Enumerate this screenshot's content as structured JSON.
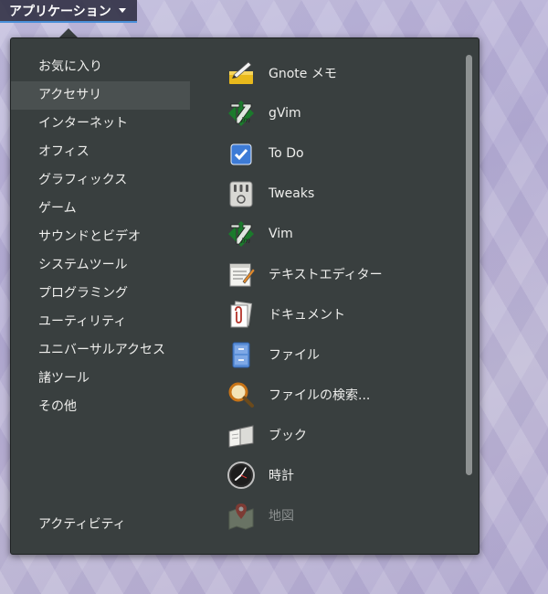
{
  "topbar": {
    "menu_label": "アプリケーション"
  },
  "categories": [
    {
      "label": "お気に入り",
      "selected": false
    },
    {
      "label": "アクセサリ",
      "selected": true
    },
    {
      "label": "インターネット",
      "selected": false
    },
    {
      "label": "オフィス",
      "selected": false
    },
    {
      "label": "グラフィックス",
      "selected": false
    },
    {
      "label": "ゲーム",
      "selected": false
    },
    {
      "label": "サウンドとビデオ",
      "selected": false
    },
    {
      "label": "システムツール",
      "selected": false
    },
    {
      "label": "プログラミング",
      "selected": false
    },
    {
      "label": "ユーティリティ",
      "selected": false
    },
    {
      "label": "ユニバーサルアクセス",
      "selected": false
    },
    {
      "label": "諸ツール",
      "selected": false
    },
    {
      "label": "その他",
      "selected": false
    }
  ],
  "activities_label": "アクティビティ",
  "apps": [
    {
      "label": "Gnote メモ",
      "icon": "gnote-icon"
    },
    {
      "label": "gVim",
      "icon": "gvim-icon"
    },
    {
      "label": "To Do",
      "icon": "todo-icon"
    },
    {
      "label": "Tweaks",
      "icon": "tweaks-icon"
    },
    {
      "label": "Vim",
      "icon": "vim-icon"
    },
    {
      "label": "テキストエディター",
      "icon": "text-editor-icon"
    },
    {
      "label": "ドキュメント",
      "icon": "document-viewer-icon"
    },
    {
      "label": "ファイル",
      "icon": "file-manager-icon"
    },
    {
      "label": "ファイルの検索...",
      "icon": "search-files-icon"
    },
    {
      "label": "ブック",
      "icon": "book-icon"
    },
    {
      "label": "時計",
      "icon": "clock-icon"
    },
    {
      "label": "地図",
      "icon": "maps-icon",
      "dimmed": true
    }
  ],
  "colors": {
    "menu_bg": "#393f3f",
    "selected_bg": "#4a5050",
    "accent": "#4a90d9"
  }
}
